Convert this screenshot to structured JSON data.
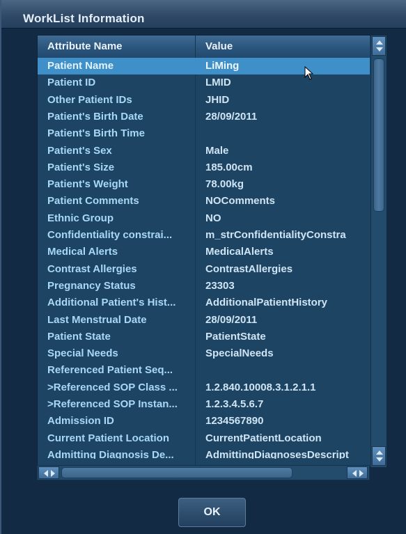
{
  "window": {
    "title": "WorkList Information"
  },
  "table": {
    "headers": {
      "attribute": "Attribute Name",
      "value": "Value"
    },
    "selected_index": 0,
    "rows": [
      {
        "attr": "Patient Name",
        "value": "LiMing"
      },
      {
        "attr": "Patient ID",
        "value": "LMID"
      },
      {
        "attr": "Other Patient IDs",
        "value": "JHID"
      },
      {
        "attr": "Patient's Birth Date",
        "value": "28/09/2011"
      },
      {
        "attr": "Patient's Birth Time",
        "value": ""
      },
      {
        "attr": "Patient's Sex",
        "value": "Male"
      },
      {
        "attr": "Patient's Size",
        "value": "185.00cm"
      },
      {
        "attr": "Patient's Weight",
        "value": "78.00kg"
      },
      {
        "attr": "Patient Comments",
        "value": "NOComments"
      },
      {
        "attr": "Ethnic Group",
        "value": "NO"
      },
      {
        "attr": "Confidentiality constrai...",
        "value": "m_strConfidentialityConstra"
      },
      {
        "attr": "Medical Alerts",
        "value": "MedicalAlerts"
      },
      {
        "attr": "Contrast Allergies",
        "value": "ContrastAllergies"
      },
      {
        "attr": "Pregnancy Status",
        "value": "23303"
      },
      {
        "attr": "Additional Patient's Hist...",
        "value": "AdditionalPatientHistory"
      },
      {
        "attr": "Last Menstrual Date",
        "value": "28/09/2011"
      },
      {
        "attr": "Patient State",
        "value": "PatientState"
      },
      {
        "attr": "Special Needs",
        "value": "SpecialNeeds"
      },
      {
        "attr": "Referenced Patient Seq...",
        "value": ""
      },
      {
        "attr": ">Referenced SOP Class ...",
        "value": "1.2.840.10008.3.1.2.1.1"
      },
      {
        "attr": ">Referenced SOP Instan...",
        "value": "1.2.3.4.5.6.7"
      },
      {
        "attr": "Admission ID",
        "value": "1234567890"
      },
      {
        "attr": "Current Patient Location",
        "value": "CurrentPatientLocation"
      },
      {
        "attr": "Admitting Diagnosis De...",
        "value": "AdmittingDiagnosesDescript"
      }
    ]
  },
  "buttons": {
    "ok": "OK"
  },
  "icons": {
    "scroll_up": "arrow-up-icon",
    "scroll_down": "arrow-down-icon",
    "scroll_left": "arrow-left-icon",
    "scroll_right": "arrow-right-icon",
    "pointer": "mouse-pointer-icon"
  },
  "colors": {
    "window_bg": "#132a45",
    "row_bg": "#1d4563",
    "selected_row": "#3f8fc8",
    "attr_text": "#a8d8f6",
    "value_text": "#cfe4f4"
  }
}
